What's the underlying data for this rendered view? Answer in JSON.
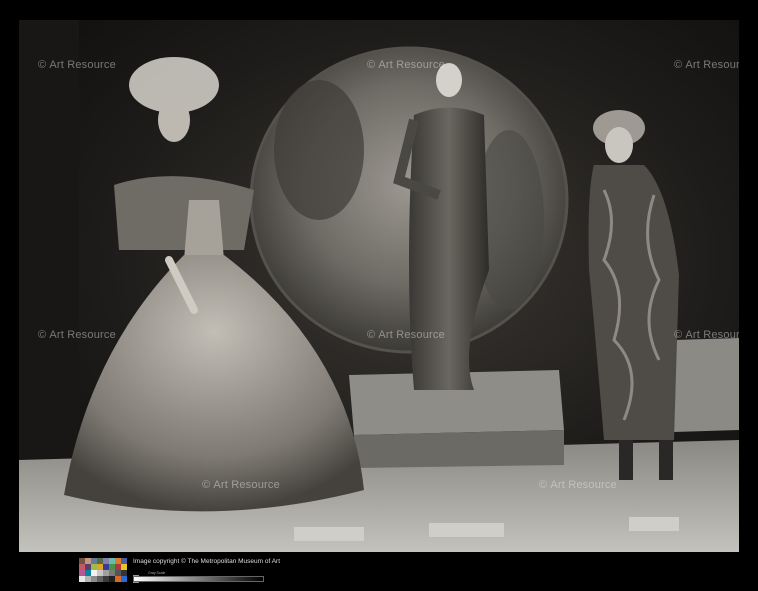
{
  "watermark": {
    "text": "Art Resource",
    "icon": "copyright-icon",
    "icon_glyph": "©"
  },
  "footer": {
    "copyright": "Image copyright © The Metropolitan Museum of Art",
    "gray_scale_label": "Gray Scale"
  },
  "colors": {
    "backdrop_dark": "#1e1c1a",
    "mirror": "#8a8780",
    "floor": "#a8a6a0",
    "gown": "#9a968f"
  }
}
